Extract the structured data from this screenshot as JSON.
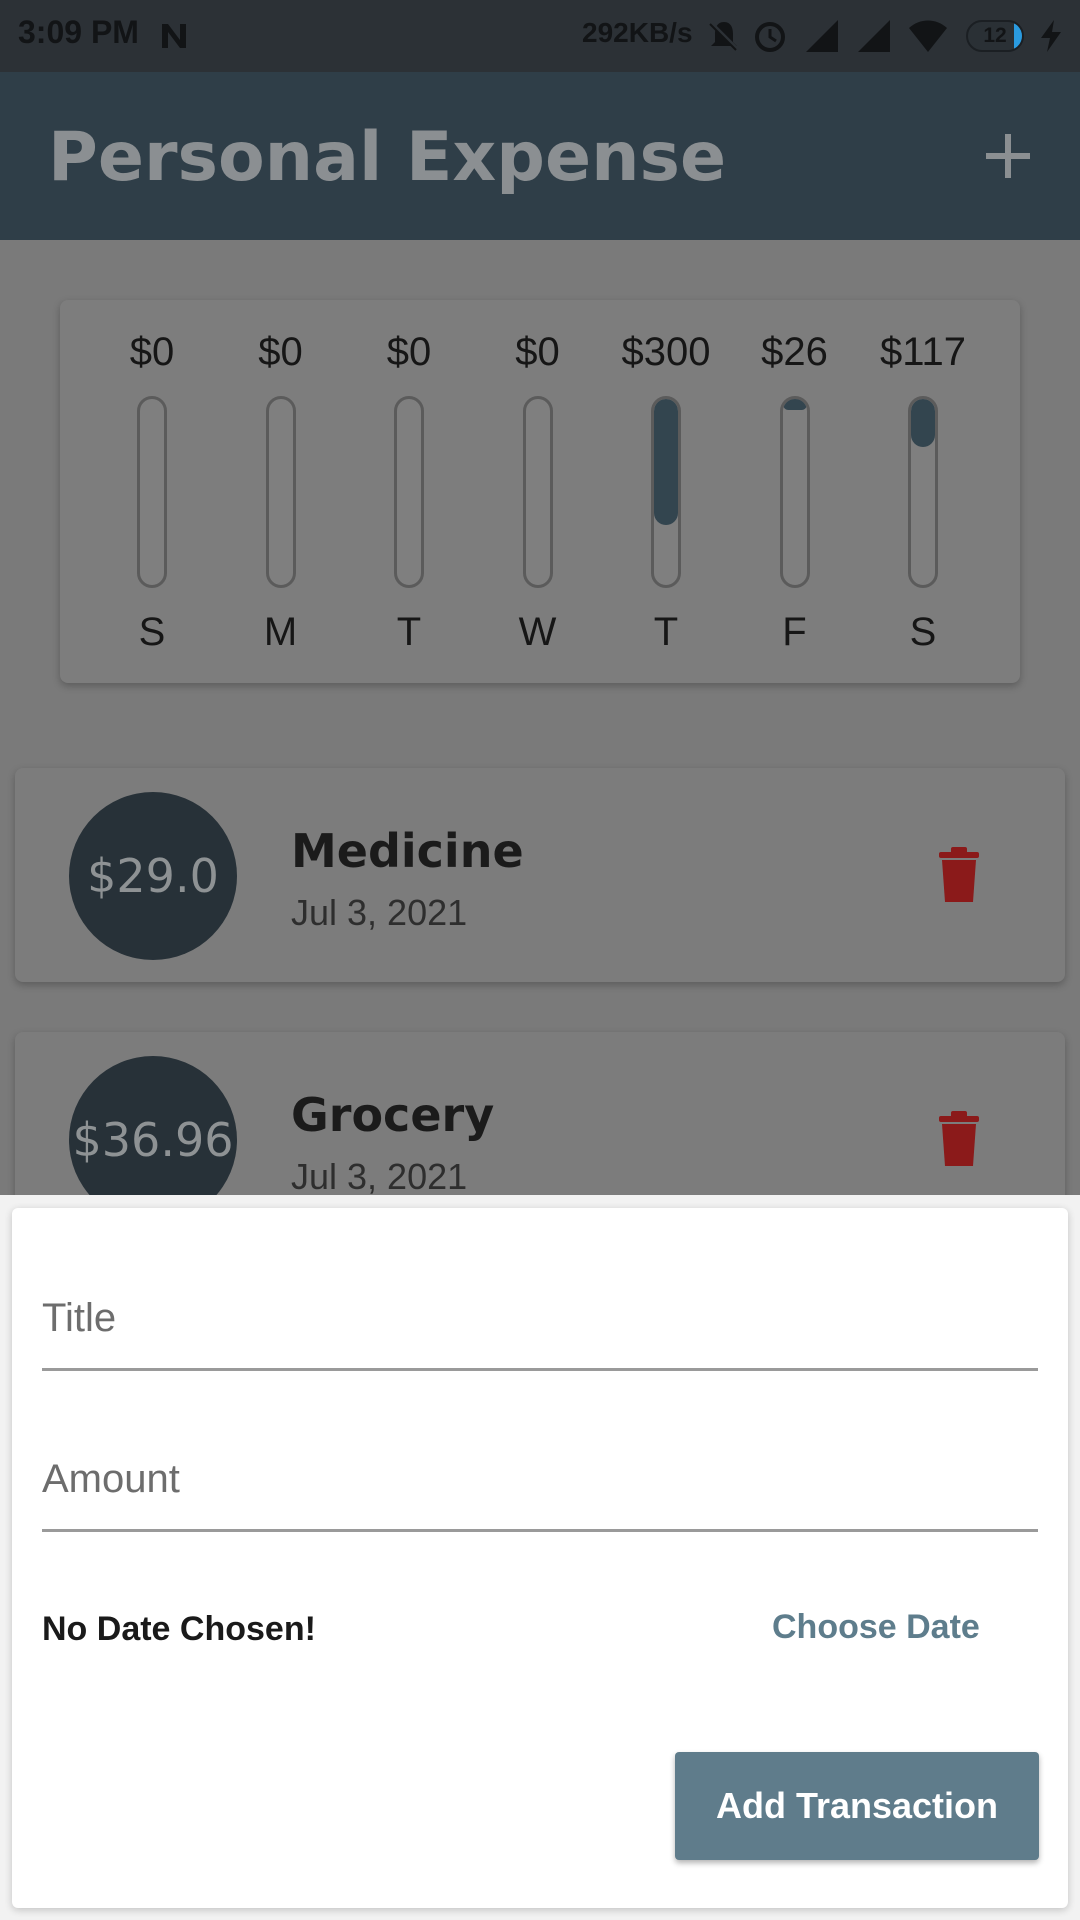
{
  "status_bar": {
    "time": "3:09 PM",
    "network_speed": "292KB/s",
    "battery_level": "12",
    "icons": [
      "n-notification-icon",
      "mute-icon",
      "alarm-icon",
      "signal-icon",
      "signal-icon",
      "wifi-icon",
      "battery-icon",
      "charging-icon"
    ]
  },
  "app_bar": {
    "title": "Personal Expense",
    "add_icon": "plus-icon"
  },
  "chart_data": {
    "type": "bar",
    "categories": [
      "S",
      "M",
      "T",
      "W",
      "T",
      "F",
      "S"
    ],
    "values": [
      0,
      0,
      0,
      0,
      300,
      26,
      117
    ],
    "value_labels": [
      "$0",
      "$0",
      "$0",
      "$0",
      "$300",
      "$26",
      "$117"
    ],
    "share_of_week": [
      0,
      0,
      0,
      0,
      0.68,
      0.06,
      0.26
    ],
    "title": "",
    "xlabel": "",
    "ylabel": ""
  },
  "transactions": [
    {
      "amount": "$29.0",
      "title": "Medicine",
      "date": "Jul 3, 2021"
    },
    {
      "amount": "$36.96",
      "title": "Grocery",
      "date": "Jul 3, 2021"
    }
  ],
  "new_transaction": {
    "title_placeholder": "Title",
    "amount_placeholder": "Amount",
    "date_status": "No Date Chosen!",
    "choose_date_label": "Choose Date",
    "submit_label": "Add Transaction"
  },
  "colors": {
    "app_bar": "#2f3e48",
    "primary": "#5f7c8b",
    "bar_fill": "#33454f",
    "delete": "#8b1a1a"
  }
}
